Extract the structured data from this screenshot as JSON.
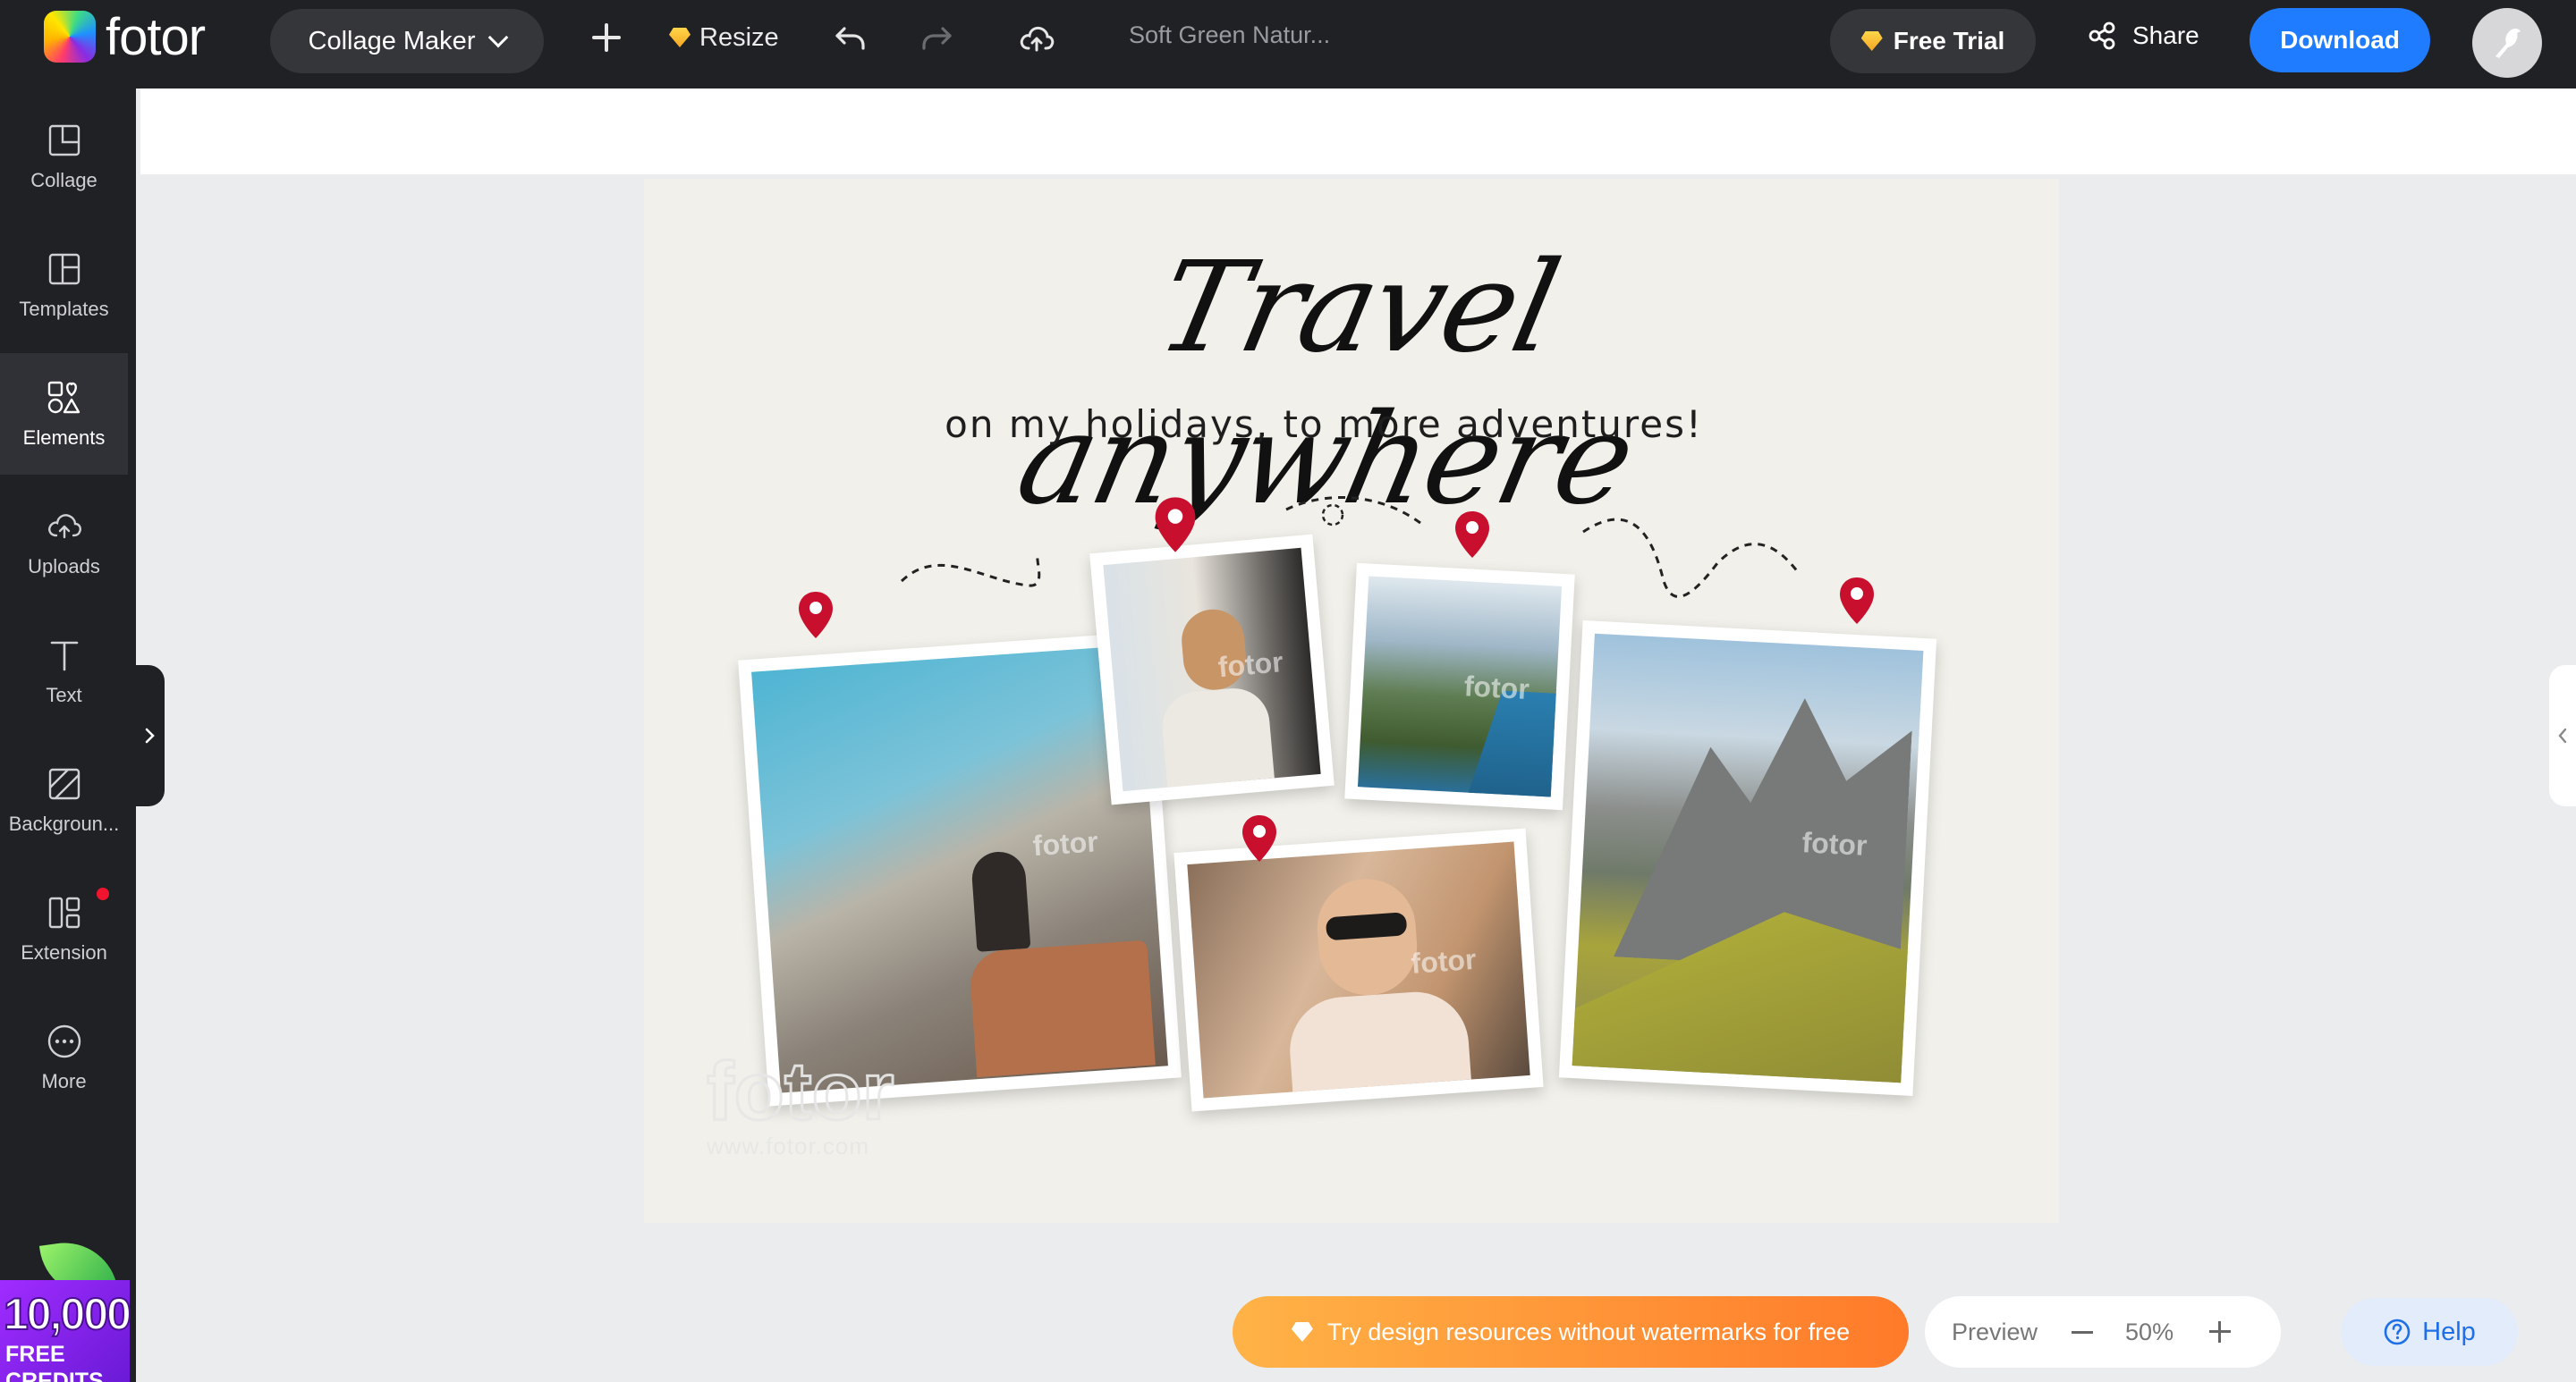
{
  "app": {
    "brand": "fotor",
    "mode_dropdown": "Collage Maker",
    "resize_label": "Resize",
    "doc_title": "Soft Green Natur...",
    "free_trial_label": "Free Trial",
    "share_label": "Share",
    "download_label": "Download",
    "accent_color": "#1f7cff"
  },
  "sidebar": {
    "items": [
      {
        "label": "Collage",
        "icon": "collage-icon"
      },
      {
        "label": "Templates",
        "icon": "templates-icon"
      },
      {
        "label": "Elements",
        "icon": "elements-icon",
        "active": true
      },
      {
        "label": "Uploads",
        "icon": "upload-cloud-icon"
      },
      {
        "label": "Text",
        "icon": "text-icon"
      },
      {
        "label": "Backgroun...",
        "icon": "background-icon"
      },
      {
        "label": "Extension",
        "icon": "extension-icon",
        "badge_dot": true
      },
      {
        "label": "More",
        "icon": "more-icon"
      }
    ],
    "credits_badge": {
      "number": "10,000",
      "label": "FREE CREDITS"
    }
  },
  "canvas": {
    "headline": "Travel anywhere",
    "subline": "on my holidays, to more adventures!",
    "watermark_logo": "fotor",
    "watermark_url": "www.fotor.com",
    "photo_watermark": "fotor",
    "pin_color": "#c8102e",
    "background": "#f1f0ea"
  },
  "bottom": {
    "promo_text": "Try design resources without watermarks for free",
    "preview_label": "Preview",
    "zoom_value": "50%",
    "help_label": "Help"
  }
}
